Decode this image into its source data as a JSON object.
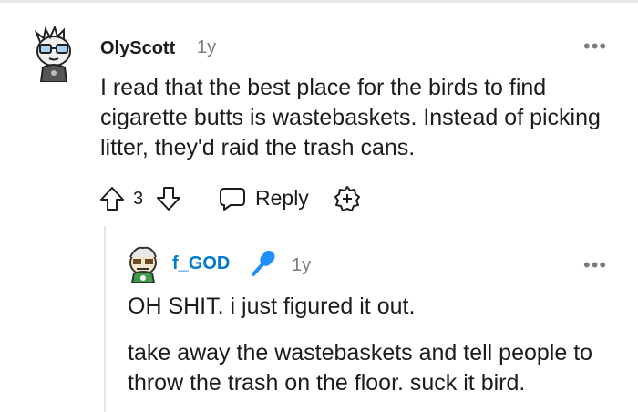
{
  "comment": {
    "author": "OlyScott",
    "age": "1y",
    "more": "•••",
    "body": "I read that the best place for the birds to find cigarette butts is wastebaskets. Instead of picking litter, they'd raid the trash cans.",
    "votes": "3",
    "reply_label": "Reply"
  },
  "reply": {
    "author": "f_GOD",
    "age": "1y",
    "more": "•••",
    "paragraphs": [
      "OH SHIT. i just figured it out.",
      "take away the wastebaskets and tell people to throw the trash on the floor. suck it bird."
    ]
  },
  "colors": {
    "text": "#1c1c1c",
    "meta": "#7c7c7c",
    "op_blue": "#0079d3",
    "mic_blue": "#1e90ff"
  },
  "icons": [
    "avatar",
    "upvote-icon",
    "downvote-icon",
    "reply-icon",
    "award-icon",
    "microphone-icon",
    "more-options-icon"
  ]
}
